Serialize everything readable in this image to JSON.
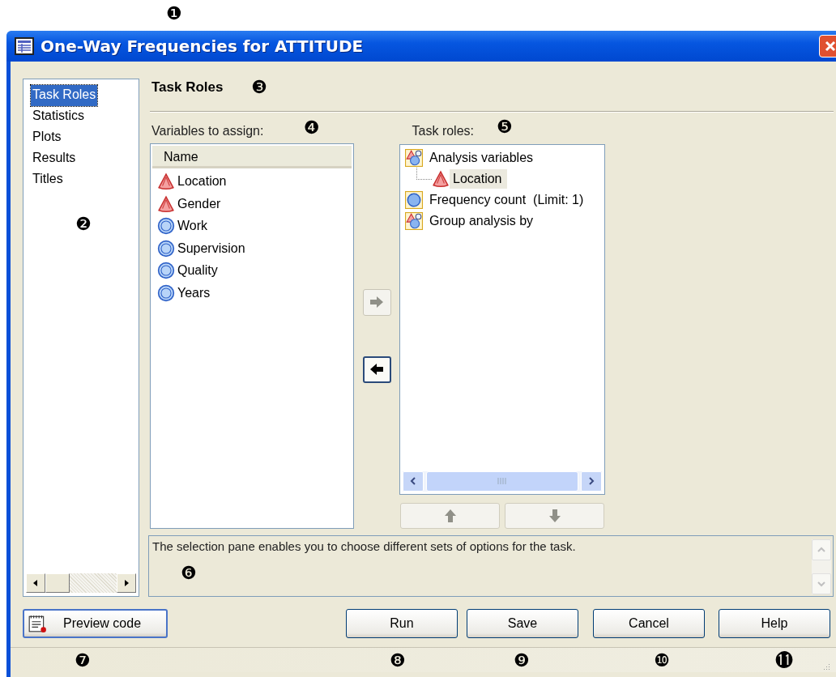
{
  "window": {
    "title": "One-Way Frequencies for ATTITUDE"
  },
  "nav": {
    "items": [
      {
        "label": "Task Roles",
        "selected": true
      },
      {
        "label": "Statistics",
        "selected": false
      },
      {
        "label": "Plots",
        "selected": false
      },
      {
        "label": "Results",
        "selected": false
      },
      {
        "label": "Titles",
        "selected": false
      }
    ]
  },
  "heading": "Task Roles",
  "variables": {
    "label": "Variables to assign:",
    "column": "Name",
    "items": [
      {
        "name": "Location",
        "kind": "character"
      },
      {
        "name": "Gender",
        "kind": "character"
      },
      {
        "name": "Work",
        "kind": "numeric"
      },
      {
        "name": "Supervision",
        "kind": "numeric"
      },
      {
        "name": "Quality",
        "kind": "numeric"
      },
      {
        "name": "Years",
        "kind": "numeric"
      }
    ]
  },
  "move_buttons": [
    {
      "kind": "right",
      "disabled": true
    },
    {
      "kind": "left",
      "disabled": false
    }
  ],
  "task_roles": {
    "label": "Task roles:",
    "items": [
      {
        "name": "Analysis variables",
        "kind": "mixed",
        "children": [
          {
            "name": "Location",
            "kind": "character",
            "selected": true
          }
        ]
      },
      {
        "name": "Frequency count  (Limit: 1)",
        "kind": "numeric"
      },
      {
        "name": "Group analysis by",
        "kind": "mixed"
      }
    ]
  },
  "order_buttons": [
    {
      "kind": "up",
      "disabled": true
    },
    {
      "kind": "down",
      "disabled": true
    }
  ],
  "description": "The selection pane enables you to choose different sets of options for the task.",
  "buttons": [
    {
      "label": "Preview code",
      "kind": "preview"
    },
    {
      "label": "Run",
      "kind": "action"
    },
    {
      "label": "Save",
      "kind": "action"
    },
    {
      "label": "Cancel",
      "kind": "action"
    },
    {
      "label": "Help",
      "kind": "action"
    }
  ],
  "callouts": [
    "❶",
    "❷",
    "❸",
    "❹",
    "❺",
    "❻",
    "❼",
    "❽",
    "❾",
    "❿",
    "⓫"
  ]
}
